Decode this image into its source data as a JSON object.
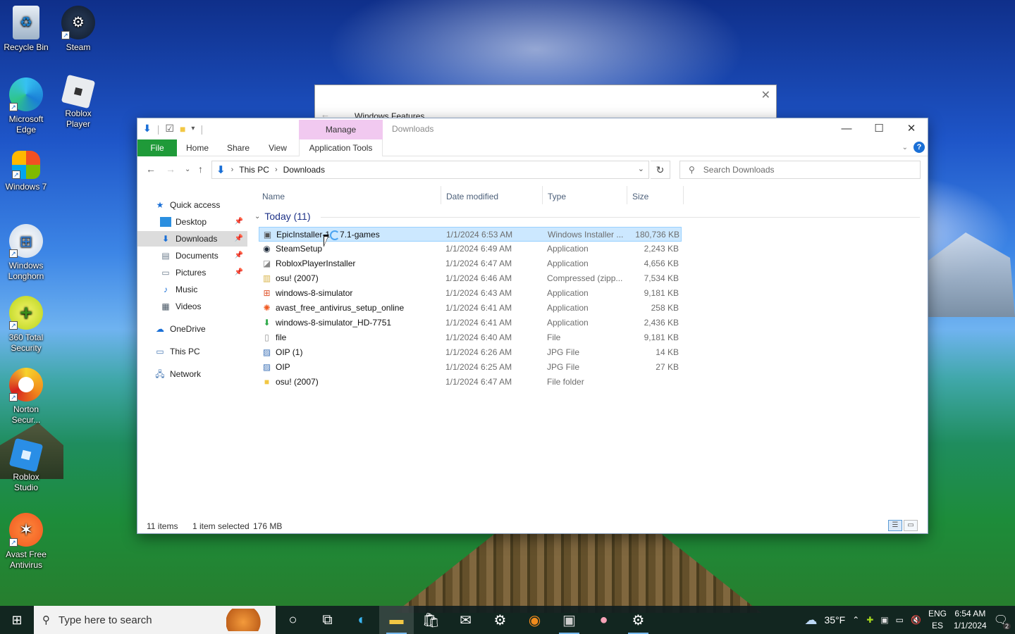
{
  "desktop": {
    "icons": [
      {
        "label": "Recycle Bin",
        "icon": "recycle-bin-icon"
      },
      {
        "label": "Steam",
        "icon": "steam-icon"
      },
      {
        "label": "Microsoft Edge",
        "icon": "edge-icon"
      },
      {
        "label": "Roblox Player",
        "icon": "roblox-icon"
      },
      {
        "label": "Windows 7",
        "icon": "windows7-icon"
      },
      {
        "label": "Windows Longhorn",
        "icon": "longhorn-icon"
      },
      {
        "label": "360 Total Security",
        "icon": "360-security-icon"
      },
      {
        "label": "Norton Secur...",
        "icon": "norton-icon"
      },
      {
        "label": "Roblox Studio",
        "icon": "roblox-studio-icon"
      },
      {
        "label": "Avast Free Antivirus",
        "icon": "avast-icon"
      }
    ]
  },
  "background_window": {
    "title": "Windows Features"
  },
  "explorer": {
    "window_title": "Downloads",
    "contextual_tab": "Manage",
    "ribbon_tabs": [
      "File",
      "Home",
      "Share",
      "View",
      "Application Tools"
    ],
    "breadcrumb": [
      "This PC",
      "Downloads"
    ],
    "search_placeholder": "Search Downloads",
    "nav": {
      "quick_access": "Quick access",
      "desktop": "Desktop",
      "downloads": "Downloads",
      "documents": "Documents",
      "pictures": "Pictures",
      "music": "Music",
      "videos": "Videos",
      "onedrive": "OneDrive",
      "this_pc": "This PC",
      "network": "Network"
    },
    "columns": {
      "name": "Name",
      "date": "Date modified",
      "type": "Type",
      "size": "Size"
    },
    "group_label": "Today (11)",
    "files": [
      {
        "name": "EpicInstaller-1",
        "name_suffix": "7.1-games",
        "date": "1/1/2024 6:53 AM",
        "type": "Windows Installer ...",
        "size": "180,736 KB"
      },
      {
        "name": "SteamSetup",
        "date": "1/1/2024 6:49 AM",
        "type": "Application",
        "size": "2,243 KB"
      },
      {
        "name": "RobloxPlayerInstaller",
        "date": "1/1/2024 6:47 AM",
        "type": "Application",
        "size": "4,656 KB"
      },
      {
        "name": "osu! (2007)",
        "date": "1/1/2024 6:46 AM",
        "type": "Compressed (zipp...",
        "size": "7,534 KB"
      },
      {
        "name": "windows-8-simulator",
        "date": "1/1/2024 6:43 AM",
        "type": "Application",
        "size": "9,181 KB"
      },
      {
        "name": "avast_free_antivirus_setup_online",
        "date": "1/1/2024 6:41 AM",
        "type": "Application",
        "size": "258 KB"
      },
      {
        "name": "windows-8-simulator_HD-7751",
        "date": "1/1/2024 6:41 AM",
        "type": "Application",
        "size": "2,436 KB"
      },
      {
        "name": "file",
        "date": "1/1/2024 6:40 AM",
        "type": "File",
        "size": "9,181 KB"
      },
      {
        "name": "OIP (1)",
        "date": "1/1/2024 6:26 AM",
        "type": "JPG File",
        "size": "14 KB"
      },
      {
        "name": "OIP",
        "date": "1/1/2024 6:25 AM",
        "type": "JPG File",
        "size": "27 KB"
      },
      {
        "name": "osu! (2007)",
        "date": "1/1/2024 6:47 AM",
        "type": "File folder",
        "size": ""
      }
    ],
    "status": {
      "items": "11 items",
      "selected": "1 item selected",
      "selected_size": "176 MB"
    }
  },
  "taskbar": {
    "search_placeholder": "Type here to search",
    "weather": "35°F",
    "lang_top": "ENG",
    "lang_bottom": "ES",
    "time": "6:54 AM",
    "date": "1/1/2024",
    "notification_count": "2"
  },
  "colors": {
    "file_tab": "#1f9a39",
    "manage_tab": "#f1c9f0",
    "selection": "#cce8ff",
    "accent": "#1a6fd6"
  }
}
